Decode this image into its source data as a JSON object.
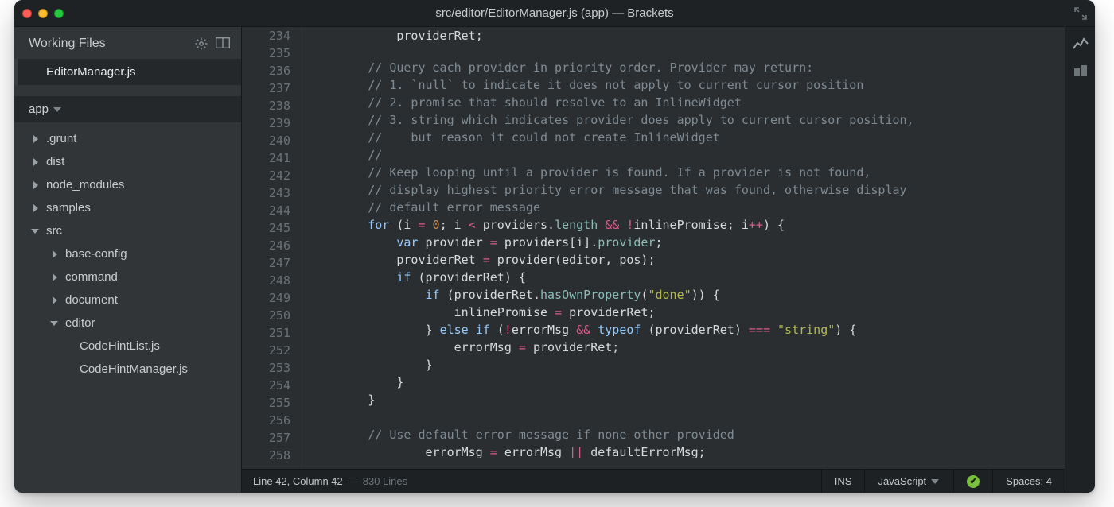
{
  "window": {
    "title": "src/editor/EditorManager.js (app) — Brackets"
  },
  "sidebar": {
    "working_files_label": "Working Files",
    "working_files": [
      {
        "name": "EditorManager.js",
        "active": true
      }
    ],
    "project_name": "app",
    "tree": [
      {
        "label": ".grunt",
        "depth": 1,
        "expanded": false
      },
      {
        "label": "dist",
        "depth": 1,
        "expanded": false
      },
      {
        "label": "node_modules",
        "depth": 1,
        "expanded": false
      },
      {
        "label": "samples",
        "depth": 1,
        "expanded": false
      },
      {
        "label": "src",
        "depth": 1,
        "expanded": true
      },
      {
        "label": "base-config",
        "depth": 2,
        "expanded": false
      },
      {
        "label": "command",
        "depth": 2,
        "expanded": false
      },
      {
        "label": "document",
        "depth": 2,
        "expanded": false
      },
      {
        "label": "editor",
        "depth": 2,
        "expanded": true
      },
      {
        "label": "CodeHintList.js",
        "depth": 3,
        "leaf": true
      },
      {
        "label": "CodeHintManager.js",
        "depth": 3,
        "leaf": true
      }
    ]
  },
  "editor": {
    "first_line_no": 234,
    "last_line_no": 258,
    "lines": {
      "234": "            providerRet;",
      "235": "",
      "236": "        // Query each provider in priority order. Provider may return:",
      "237": "        // 1. `null` to indicate it does not apply to current cursor position",
      "238": "        // 2. promise that should resolve to an InlineWidget",
      "239": "        // 3. string which indicates provider does apply to current cursor position,",
      "240": "        //    but reason it could not create InlineWidget",
      "241": "        //",
      "242": "        // Keep looping until a provider is found. If a provider is not found,",
      "243": "        // display highest priority error message that was found, otherwise display",
      "244": "        // default error message",
      "245": "        for (i = 0; i < providers.length && !inlinePromise; i++) {",
      "246": "            var provider = providers[i].provider;",
      "247": "            providerRet = provider(editor, pos);",
      "248": "            if (providerRet) {",
      "249": "                if (providerRet.hasOwnProperty(\"done\")) {",
      "250": "                    inlinePromise = providerRet;",
      "251": "                } else if (!errorMsg && typeof (providerRet) === \"string\") {",
      "252": "                    errorMsg = providerRet;",
      "253": "                }",
      "254": "            }",
      "255": "        }",
      "256": "",
      "257": "        // Use default error message if none other provided",
      "258": "                errorMsg = errorMsg || defaultErrorMsg;"
    }
  },
  "status": {
    "cursor": "Line 42, Column 42",
    "lines_sep": " — ",
    "total_lines": "830 Lines",
    "insert_mode": "INS",
    "language": "JavaScript",
    "indent": "Spaces: 4"
  },
  "icons": {
    "gear": "gear-icon",
    "split": "split-view-icon",
    "expand": "expand-window-icon",
    "live": "live-preview-icon",
    "extension": "extension-manager-icon",
    "caret_down": "caret-down-icon"
  }
}
